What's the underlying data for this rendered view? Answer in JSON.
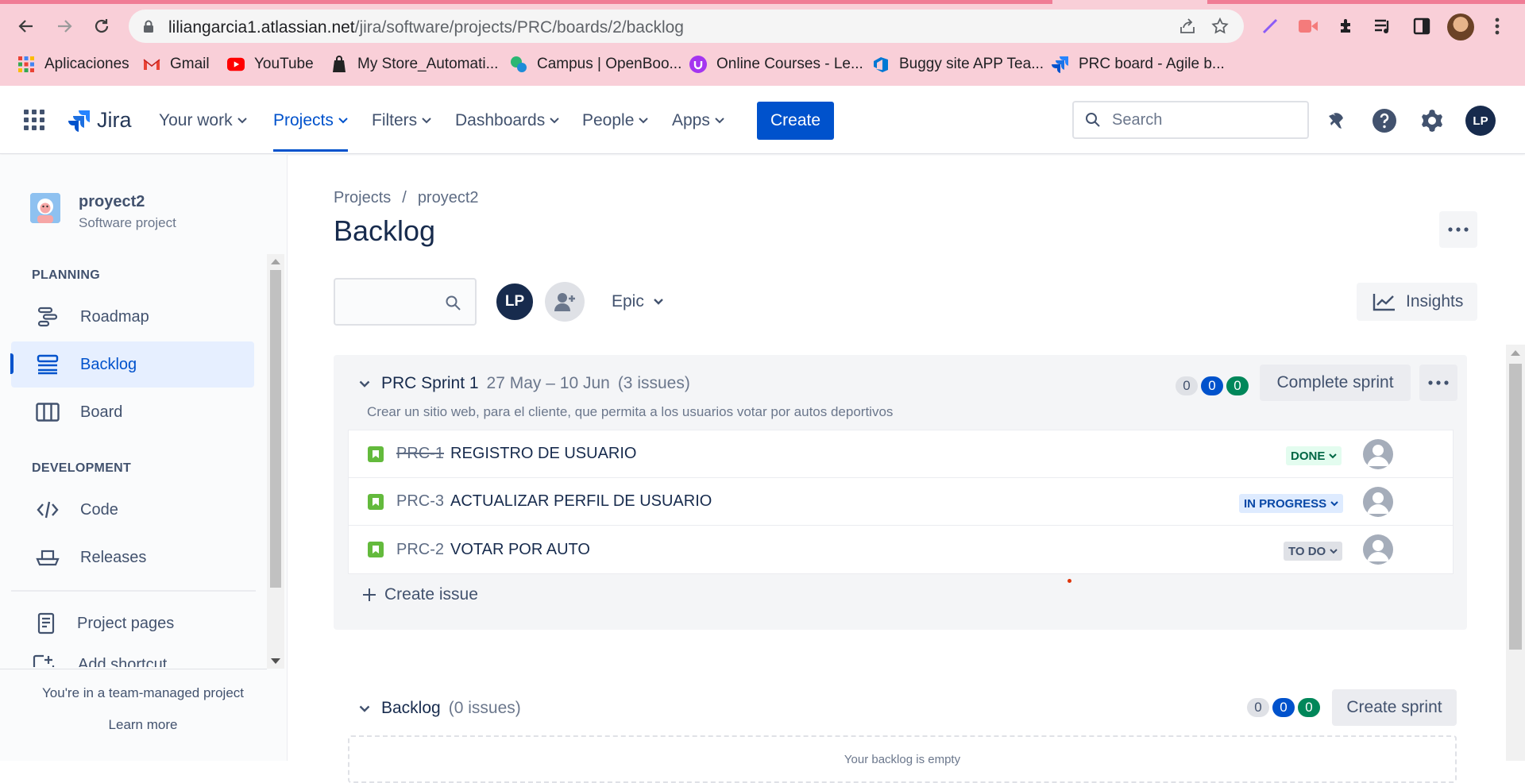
{
  "browser": {
    "url_host": "liliangarcia1.atlassian.net",
    "url_path": "/jira/software/projects/PRC/boards/2/backlog",
    "bookmarks": [
      {
        "label": "Aplicaciones",
        "icon": "apps-grid-icon"
      },
      {
        "label": "Gmail",
        "icon": "gmail-icon"
      },
      {
        "label": "YouTube",
        "icon": "youtube-icon"
      },
      {
        "label": "My Store_Automati...",
        "icon": "store-icon"
      },
      {
        "label": "Campus | OpenBoo...",
        "icon": "campus-icon"
      },
      {
        "label": "Online Courses - Le...",
        "icon": "udemy-icon"
      },
      {
        "label": "Buggy site APP Tea...",
        "icon": "azure-devops-icon"
      },
      {
        "label": "PRC board - Agile b...",
        "icon": "jira-icon"
      }
    ]
  },
  "topnav": {
    "product": "Jira",
    "items": [
      {
        "label": "Your work"
      },
      {
        "label": "Projects"
      },
      {
        "label": "Filters"
      },
      {
        "label": "Dashboards"
      },
      {
        "label": "People"
      },
      {
        "label": "Apps"
      }
    ],
    "create_label": "Create",
    "search_placeholder": "Search",
    "avatar_initials": "LP"
  },
  "sidebar": {
    "project_name": "proyect2",
    "project_type": "Software project",
    "planning_heading": "PLANNING",
    "planning_items": [
      {
        "label": "Roadmap",
        "icon": "roadmap-icon"
      },
      {
        "label": "Backlog",
        "icon": "backlog-icon"
      },
      {
        "label": "Board",
        "icon": "board-icon"
      }
    ],
    "development_heading": "DEVELOPMENT",
    "development_items": [
      {
        "label": "Code",
        "icon": "code-icon"
      },
      {
        "label": "Releases",
        "icon": "releases-icon"
      }
    ],
    "project_pages": "Project pages",
    "add_shortcut": "Add shortcut",
    "footer_text": "You're in a team-managed project",
    "learn_more": "Learn more"
  },
  "main": {
    "breadcrumb": [
      "Projects",
      "proyect2"
    ],
    "title": "Backlog",
    "avatar_initials": "LP",
    "epic_label": "Epic",
    "insights_label": "Insights",
    "sprint": {
      "name": "PRC Sprint 1",
      "dates": "27 May – 10 Jun",
      "count": "(3 issues)",
      "goal": "Crear un sitio web, para el cliente, que permita a los usuarios votar por autos deportivos",
      "pills": [
        "0",
        "0",
        "0"
      ],
      "complete_label": "Complete sprint",
      "issues": [
        {
          "key": "PRC-1",
          "summary": "REGISTRO DE USUARIO",
          "status": "DONE"
        },
        {
          "key": "PRC-3",
          "summary": "ACTUALIZAR PERFIL DE USUARIO",
          "status": "IN PROGRESS"
        },
        {
          "key": "PRC-2",
          "summary": "VOTAR POR AUTO",
          "status": "TO DO"
        }
      ],
      "create_issue_label": "Create issue"
    },
    "backlog": {
      "name": "Backlog",
      "count": "(0 issues)",
      "pills": [
        "0",
        "0",
        "0"
      ],
      "create_sprint_label": "Create sprint",
      "empty_text": "Your backlog is empty"
    }
  },
  "colors": {
    "brand_blue": "#0052cc",
    "chrome_bg": "#f9cfd8",
    "done_green": "#00875a"
  }
}
